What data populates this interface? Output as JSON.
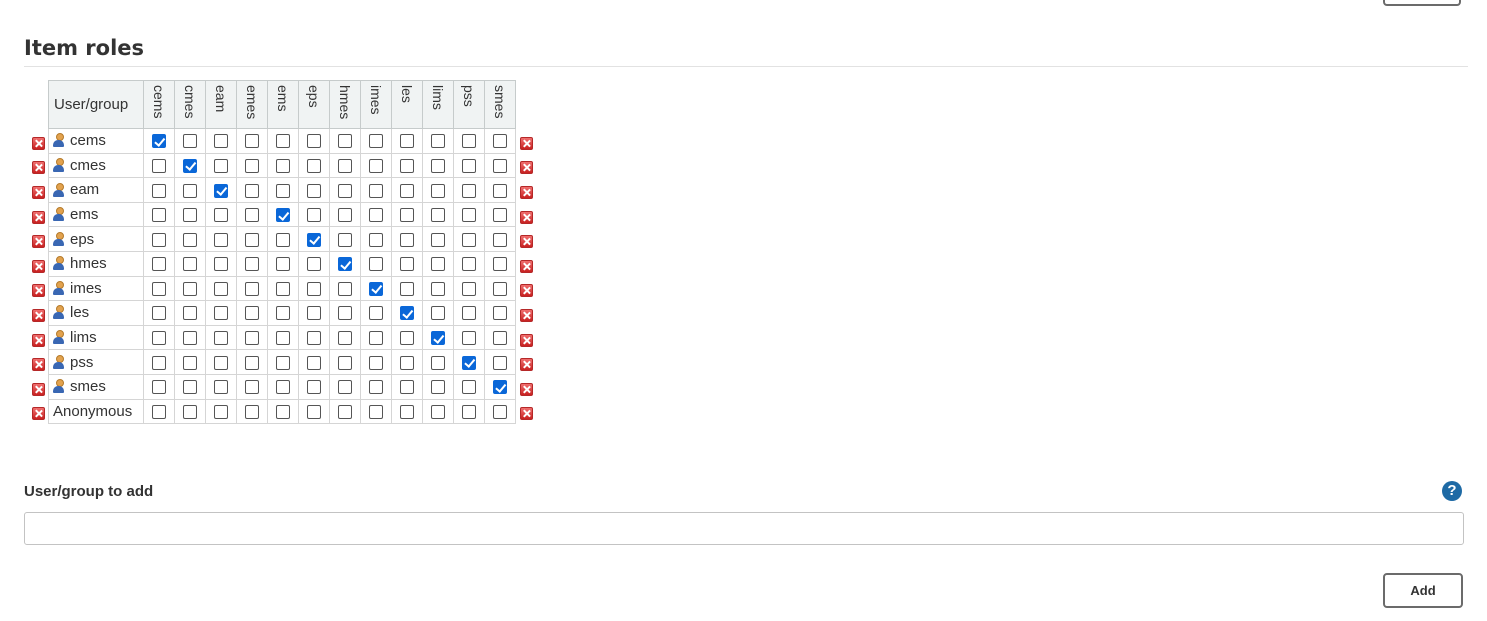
{
  "section": {
    "title": "Item roles"
  },
  "matrix": {
    "user_column_header": "User/group",
    "roles": [
      "cems",
      "cmes",
      "eam",
      "emes",
      "ems",
      "eps",
      "hmes",
      "imes",
      "les",
      "lims",
      "pss",
      "smes"
    ],
    "rows": [
      {
        "name": "cems",
        "type": "user",
        "checked": [
          0
        ]
      },
      {
        "name": "cmes",
        "type": "user",
        "checked": [
          1
        ]
      },
      {
        "name": "eam",
        "type": "user",
        "checked": [
          2
        ]
      },
      {
        "name": "ems",
        "type": "user",
        "checked": [
          4
        ]
      },
      {
        "name": "eps",
        "type": "user",
        "checked": [
          5
        ]
      },
      {
        "name": "hmes",
        "type": "user",
        "checked": [
          6
        ]
      },
      {
        "name": "imes",
        "type": "user",
        "checked": [
          7
        ]
      },
      {
        "name": "les",
        "type": "user",
        "checked": [
          8
        ]
      },
      {
        "name": "lims",
        "type": "user",
        "checked": [
          9
        ]
      },
      {
        "name": "pss",
        "type": "user",
        "checked": [
          10
        ]
      },
      {
        "name": "smes",
        "type": "user",
        "checked": [
          11
        ]
      },
      {
        "name": "Anonymous",
        "type": "anonymous",
        "checked": []
      }
    ],
    "icons": {
      "delete": "delete-icon",
      "user": "user-icon"
    }
  },
  "add_section": {
    "label": "User/group to add",
    "input_value": "",
    "help_icon": "?",
    "add_button": "Add"
  },
  "colors": {
    "checkbox_checked": "#0a67d8",
    "help_icon": "#1e6aa5",
    "delete_icon": "#c82020",
    "header_background": "#f0f3f3"
  }
}
